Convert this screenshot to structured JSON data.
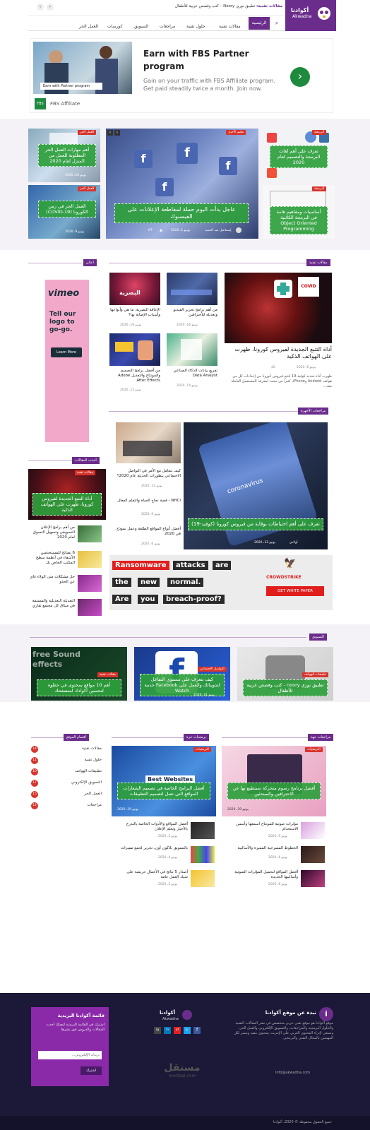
{
  "header": {
    "logo_ar": "أكوادنا",
    "logo_en": "Akwadna",
    "ticker_label": "مقالات تقنية:",
    "ticker_text": "تطبيق نوري Noory – كتب وقصص عربية للأطفال"
  },
  "nav": {
    "home": "الرئيسية",
    "items": [
      "مقالات تقنية",
      "حلول تقنية",
      "مراجعات",
      "التسويق",
      "كورسات",
      "العمل الحر"
    ]
  },
  "ad1": {
    "title_line1": "Earn with FBS Partner",
    "title_line2": "program",
    "desc": "Gain on your traffic with FBS Affiliate program. Get paid steadily twice a month. Join now.",
    "image_caption_bold": "Partner",
    "image_caption": "Earn with Partner program",
    "brand": "FBS Affiliate",
    "brand_short": "FBS",
    "arrow": "›"
  },
  "hero": {
    "left_top": {
      "tag": "العمل الحر",
      "title": "أهم مهارات العمل الحر المطلوبة للعمل من المنزل لعام 2020",
      "date": "يونيو 26، 2020"
    },
    "left_bottom": {
      "tag": "العمل الحر",
      "title": "العمل الحر في زمن الكورونا (COVID-19)",
      "date": "يونيو 9، 2020"
    },
    "center": {
      "tag": "تعليم الأخبار",
      "title": "عاجل بدأت اليوم حملة لمقاطعة الإعلانات على الفيسبوك",
      "author": "إسماعيل عبد الحميد",
      "date": "يونيو 1، 2020",
      "views": "67"
    },
    "right_top": {
      "tag": "البرمجة",
      "title": "تعرف على أهم لغات البرمجة والتصميم لعام 2020"
    },
    "right_bottom": {
      "tag": "البرمجة",
      "title": "أساسيات ومفاهيم هامة في البرمجة الكائنية Object Oriented Programming"
    }
  },
  "tech_section": {
    "title": "مقالات تقنية",
    "main": {
      "title": "أداة التتبع الجديدة لفيروس كورونا، ظهرت على الهواتف الذكية",
      "date": "يونيو 6، 2020",
      "views": "42",
      "excerpt": "ظهرت أداة تحديد كوفيد-19 لتتبع فيروس كورونا من إعدادات كل من هواتف Android وiPhone، كثيرا من تبحث لمعرفة المستعمل العاملة معه..."
    },
    "items": [
      {
        "title": "من أهم برامج تحرير الفيديو وتعديله للأحترافين",
        "date": "يونيو 16، 2020"
      },
      {
        "title": "الإعاقة البصرية: ما هي وأنواعها وأسباب الإصابة بها؟",
        "date": "يونيو 16، 2020"
      },
      {
        "title": "تفريغ بيانات الذكاء الصناعي Data Analyst",
        "date": "يونيو 14، 2020"
      },
      {
        "title": "من أفضل برامج التصميم والمونتاج والتعديل Adobe After Effects",
        "date": "يونيو 12، 2020"
      }
    ],
    "image_text": "البصرية"
  },
  "sidebar": {
    "ad_title": "Tell our logo to go-go.",
    "ad_brand": "vimeo",
    "ad_button": "Learn More",
    "ad_label": "اعلان",
    "popular_title": "أحدث المقالات",
    "popular_main": {
      "tag": "مقالات تقنية",
      "title": "أداة التتبع الجديدة لفيروس كورونا، ظهرت على الهواتف الذكية"
    },
    "popular_items": [
      {
        "title": "من أهم برامج الإعلان التسويقي وتسهيل التسوق لعام 2020"
      },
      {
        "title": "6 نصائح للمستخدمين الأشقاء في أنظمة سطح المكتب الخاص بك"
      },
      {
        "title": "حل مشكلات متى الولاء غاي عن الحذو"
      },
      {
        "title": "التعديلة التعديلية والمستمة في ميثاق كل مجتمع تقاري"
      }
    ]
  },
  "solutions_section": {
    "title": "مراجعات الأجهزة",
    "main": {
      "title": "تعرف على أهم احتياطات بوقاية من فيروس كورونا (كوفيد-19)",
      "author": "أولادي",
      "date": "يونيو 12، 2020"
    },
    "items": [
      {
        "title": "كيف تتعامل مع الأمر في التواصل الاجتماعي بتطورات الحديثة عام 2020؟",
        "date": "يونيو 12، 2020"
      },
      {
        "title": "NHCI - قصة نجاح الحياة والتعلم الفعال",
        "date": "يونيو 9، 2020"
      },
      {
        "title": "أفضل أنواع المواقع الطلقة وعمل نموذج في 2020",
        "date": "يونيو 6، 2020"
      }
    ],
    "phone_text": "coronavirus"
  },
  "ad2": {
    "words": [
      "Ransomware",
      "attacks",
      "are",
      "the",
      "new",
      "normal.",
      "Are",
      "you",
      "breach-proof?"
    ],
    "brand": "CROWDSTRIKE",
    "button": "GET WHITE PAPER"
  },
  "marketing_section": {
    "title": "التسويق",
    "cards": [
      {
        "tag": "تطبيقات الهواتف",
        "title": "تطبيق نوري noory - كتب وقصص عربية للأطفال",
        "date": "يونيو 12، 2020"
      },
      {
        "tag": "التواصل الاجتماعي",
        "title": "كيف تتعرف على مستوى التفاعل لتدويناتك والعمل على Facebook خدمة Watch",
        "date": "يونيو 11، 2020"
      },
      {
        "tag": "مقالات تقنية",
        "title": "أهم 10 مواقع بمحتوى في خطوة لتحسين أكوادك لمتصفحك",
        "date": "يونيو 10، 2020"
      }
    ],
    "sound_text": "free Sound effects"
  },
  "bottom": {
    "col1": {
      "title": "مراجعات جهة",
      "main": {
        "tag": "البرمجيات",
        "title": "أفضل برنامج رسوم متحركة تستطيع بها عن الاحترافين والمبتدئين",
        "date": "يونيو 29، 2020"
      },
      "items": [
        {
          "title": "مؤثرات صوتية للمونتاج اسمعها وأسس الاستخدام",
          "date": "يونيو 9، 2020"
        },
        {
          "title": "الخطوط المسرحية المميزة والأساليبة",
          "date": "يونيو 8، 2020"
        },
        {
          "title": "أفضل المواقع لتحميل المؤثرات الصوتية وأساليبها الجديدة",
          "date": "يونيو 6، 2020"
        }
      ]
    },
    "col2": {
      "title": "برمجيات حرة",
      "main": {
        "tag": "البرمجيات",
        "title": "أفضل البرامج الخاصة في تصميم الشعارات المواقع التي تصل لتصميم التطبيقات",
        "date": "يونيو 29، 2020"
      },
      "image_text": "Best Websites",
      "items": [
        {
          "title": "أفضل المواقع والأدوات الخاصة بالتدرج بالأخبار وتعلم الإعلان",
          "date": "يونيو 5، 2020"
        },
        {
          "title": "بالتسويق بلاكون أون، تحرير لجمع مميزات",
          "date": "يونيو 4، 2020"
        },
        {
          "title": "أصدار 5 نتائج في الأعمال حريصة على شيك العمل عامة",
          "date": "يونيو 2، 2020"
        }
      ]
    },
    "col3": {
      "title": "أقسام الموقع",
      "categories": [
        {
          "name": "مقالات تقنية",
          "count": "14"
        },
        {
          "name": "حلول تقنية",
          "count": "11"
        },
        {
          "name": "تطبيقات الهواتف",
          "count": "10"
        },
        {
          "name": "التسويق الإلكتروني",
          "count": "17"
        },
        {
          "name": "العمل الحر",
          "count": "15"
        },
        {
          "name": "مراجعات",
          "count": "12"
        }
      ]
    }
  },
  "footer": {
    "about_title": "نبذة عن موقع أكوادنا",
    "about_text": "موقع أكوادنا هو موقع تقني عربي متخصص في نشر المقالات التقنية والحلول البرمجية والمراجعات، والتسويق الإلكتروني والعمل الحر، ونسعى لإثراء المحتوى العربي على الإنترنت بمحتوى مفيد ومميز لكل المهتمين بالمجال التقني والبرمجي.",
    "email": "info@akwadna.com",
    "logo_ar": "أكوادنا",
    "logo_en": "Akwadna",
    "newsletter_title": "قائمة أكوادنا البريدية",
    "newsletter_text": "اشترك في القائمة البريدية لتصلك أحدث المقالات والدروس فور نشرها",
    "newsletter_placeholder": "بريدك الإلكتروني...",
    "newsletter_button": "اشترك",
    "watermark": "مستقل",
    "watermark_en": "mostaql.com",
    "copyright": "جميع الحقوق محفوظة © 2020، أكوادنا",
    "social": [
      "f",
      "t",
      "yt",
      "in",
      "ig"
    ]
  },
  "colors": {
    "purple": "#6b2d8c",
    "green": "#2ea03c",
    "red": "#d8342c",
    "footer_bg": "#1b1838"
  }
}
